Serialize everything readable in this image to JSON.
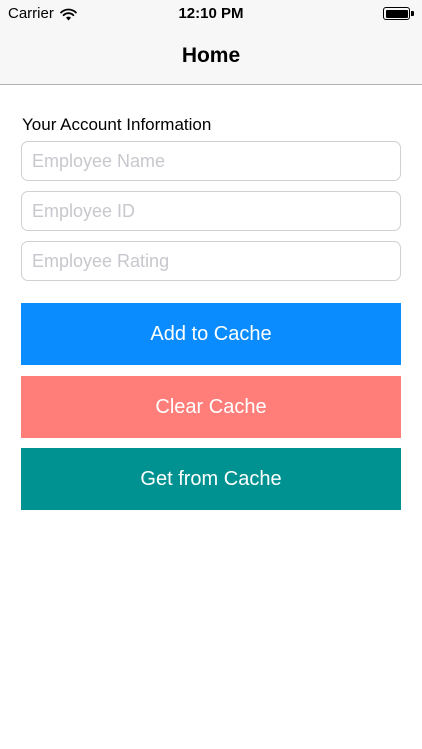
{
  "status_bar": {
    "carrier": "Carrier",
    "time": "12:10 PM",
    "wifi_icon": "wifi-icon",
    "battery_icon": "battery-icon"
  },
  "nav": {
    "title": "Home"
  },
  "form": {
    "section_label": "Your Account Information",
    "employee_name_placeholder": "Employee Name",
    "employee_id_placeholder": "Employee ID",
    "employee_rating_placeholder": "Employee Rating"
  },
  "buttons": {
    "add_label": "Add to Cache",
    "clear_label": "Clear Cache",
    "get_label": "Get from Cache"
  },
  "colors": {
    "add_button": "#0a8cff",
    "clear_button": "#ff7e79",
    "get_button": "#009191",
    "bar_background": "#f7f7f7"
  }
}
